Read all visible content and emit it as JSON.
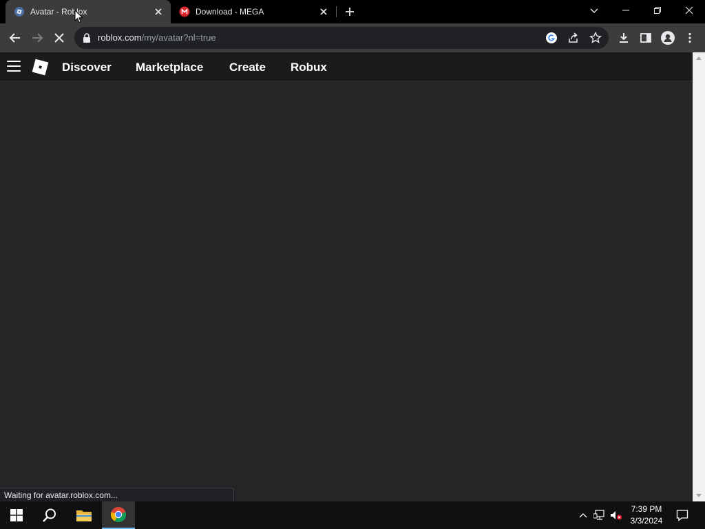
{
  "tabs": [
    {
      "title": "Avatar - Roblox",
      "favicon": "roblox-loading-icon",
      "active": true
    },
    {
      "title": "Download - MEGA",
      "favicon": "mega-icon",
      "active": false
    }
  ],
  "address_bar": {
    "host": "roblox.com",
    "path": "/my/avatar?nl=true"
  },
  "site_nav": {
    "items": [
      "Discover",
      "Marketplace",
      "Create",
      "Robux"
    ]
  },
  "status_bar": "Waiting for avatar.roblox.com...",
  "taskbar": {
    "time": "7:39 PM",
    "date": "3/3/2024"
  },
  "colors": {
    "page_bg": "#232527",
    "site_header_bg": "#191b1d",
    "chrome_toolbar": "#3c3c3c",
    "mega_red": "#d9272e",
    "accent": "#76b9ed"
  }
}
